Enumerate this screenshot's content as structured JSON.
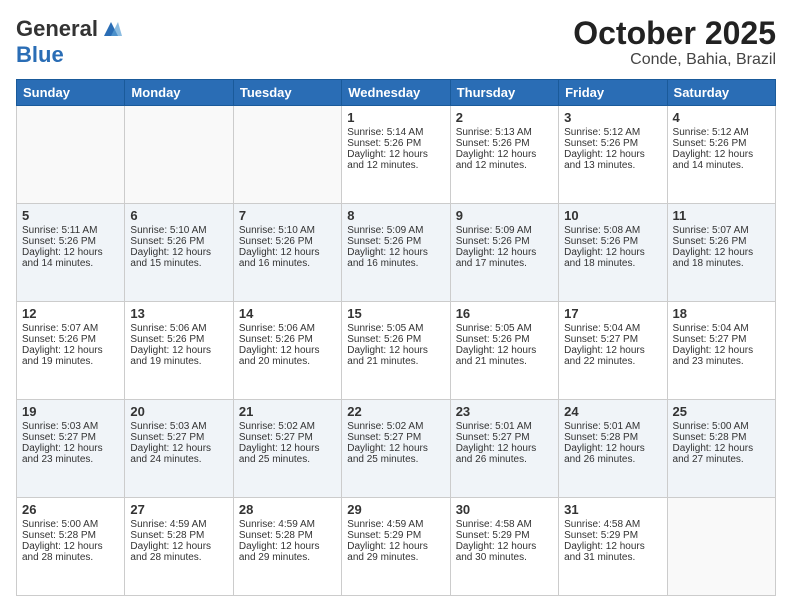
{
  "header": {
    "logo_general": "General",
    "logo_blue": "Blue",
    "title": "October 2025",
    "subtitle": "Conde, Bahia, Brazil"
  },
  "days_of_week": [
    "Sunday",
    "Monday",
    "Tuesday",
    "Wednesday",
    "Thursday",
    "Friday",
    "Saturday"
  ],
  "weeks": [
    [
      {
        "day": "",
        "info": ""
      },
      {
        "day": "",
        "info": ""
      },
      {
        "day": "",
        "info": ""
      },
      {
        "day": "1",
        "info": "Sunrise: 5:14 AM\nSunset: 5:26 PM\nDaylight: 12 hours\nand 12 minutes."
      },
      {
        "day": "2",
        "info": "Sunrise: 5:13 AM\nSunset: 5:26 PM\nDaylight: 12 hours\nand 12 minutes."
      },
      {
        "day": "3",
        "info": "Sunrise: 5:12 AM\nSunset: 5:26 PM\nDaylight: 12 hours\nand 13 minutes."
      },
      {
        "day": "4",
        "info": "Sunrise: 5:12 AM\nSunset: 5:26 PM\nDaylight: 12 hours\nand 14 minutes."
      }
    ],
    [
      {
        "day": "5",
        "info": "Sunrise: 5:11 AM\nSunset: 5:26 PM\nDaylight: 12 hours\nand 14 minutes."
      },
      {
        "day": "6",
        "info": "Sunrise: 5:10 AM\nSunset: 5:26 PM\nDaylight: 12 hours\nand 15 minutes."
      },
      {
        "day": "7",
        "info": "Sunrise: 5:10 AM\nSunset: 5:26 PM\nDaylight: 12 hours\nand 16 minutes."
      },
      {
        "day": "8",
        "info": "Sunrise: 5:09 AM\nSunset: 5:26 PM\nDaylight: 12 hours\nand 16 minutes."
      },
      {
        "day": "9",
        "info": "Sunrise: 5:09 AM\nSunset: 5:26 PM\nDaylight: 12 hours\nand 17 minutes."
      },
      {
        "day": "10",
        "info": "Sunrise: 5:08 AM\nSunset: 5:26 PM\nDaylight: 12 hours\nand 18 minutes."
      },
      {
        "day": "11",
        "info": "Sunrise: 5:07 AM\nSunset: 5:26 PM\nDaylight: 12 hours\nand 18 minutes."
      }
    ],
    [
      {
        "day": "12",
        "info": "Sunrise: 5:07 AM\nSunset: 5:26 PM\nDaylight: 12 hours\nand 19 minutes."
      },
      {
        "day": "13",
        "info": "Sunrise: 5:06 AM\nSunset: 5:26 PM\nDaylight: 12 hours\nand 19 minutes."
      },
      {
        "day": "14",
        "info": "Sunrise: 5:06 AM\nSunset: 5:26 PM\nDaylight: 12 hours\nand 20 minutes."
      },
      {
        "day": "15",
        "info": "Sunrise: 5:05 AM\nSunset: 5:26 PM\nDaylight: 12 hours\nand 21 minutes."
      },
      {
        "day": "16",
        "info": "Sunrise: 5:05 AM\nSunset: 5:26 PM\nDaylight: 12 hours\nand 21 minutes."
      },
      {
        "day": "17",
        "info": "Sunrise: 5:04 AM\nSunset: 5:27 PM\nDaylight: 12 hours\nand 22 minutes."
      },
      {
        "day": "18",
        "info": "Sunrise: 5:04 AM\nSunset: 5:27 PM\nDaylight: 12 hours\nand 23 minutes."
      }
    ],
    [
      {
        "day": "19",
        "info": "Sunrise: 5:03 AM\nSunset: 5:27 PM\nDaylight: 12 hours\nand 23 minutes."
      },
      {
        "day": "20",
        "info": "Sunrise: 5:03 AM\nSunset: 5:27 PM\nDaylight: 12 hours\nand 24 minutes."
      },
      {
        "day": "21",
        "info": "Sunrise: 5:02 AM\nSunset: 5:27 PM\nDaylight: 12 hours\nand 25 minutes."
      },
      {
        "day": "22",
        "info": "Sunrise: 5:02 AM\nSunset: 5:27 PM\nDaylight: 12 hours\nand 25 minutes."
      },
      {
        "day": "23",
        "info": "Sunrise: 5:01 AM\nSunset: 5:27 PM\nDaylight: 12 hours\nand 26 minutes."
      },
      {
        "day": "24",
        "info": "Sunrise: 5:01 AM\nSunset: 5:28 PM\nDaylight: 12 hours\nand 26 minutes."
      },
      {
        "day": "25",
        "info": "Sunrise: 5:00 AM\nSunset: 5:28 PM\nDaylight: 12 hours\nand 27 minutes."
      }
    ],
    [
      {
        "day": "26",
        "info": "Sunrise: 5:00 AM\nSunset: 5:28 PM\nDaylight: 12 hours\nand 28 minutes."
      },
      {
        "day": "27",
        "info": "Sunrise: 4:59 AM\nSunset: 5:28 PM\nDaylight: 12 hours\nand 28 minutes."
      },
      {
        "day": "28",
        "info": "Sunrise: 4:59 AM\nSunset: 5:28 PM\nDaylight: 12 hours\nand 29 minutes."
      },
      {
        "day": "29",
        "info": "Sunrise: 4:59 AM\nSunset: 5:29 PM\nDaylight: 12 hours\nand 29 minutes."
      },
      {
        "day": "30",
        "info": "Sunrise: 4:58 AM\nSunset: 5:29 PM\nDaylight: 12 hours\nand 30 minutes."
      },
      {
        "day": "31",
        "info": "Sunrise: 4:58 AM\nSunset: 5:29 PM\nDaylight: 12 hours\nand 31 minutes."
      },
      {
        "day": "",
        "info": ""
      }
    ]
  ]
}
